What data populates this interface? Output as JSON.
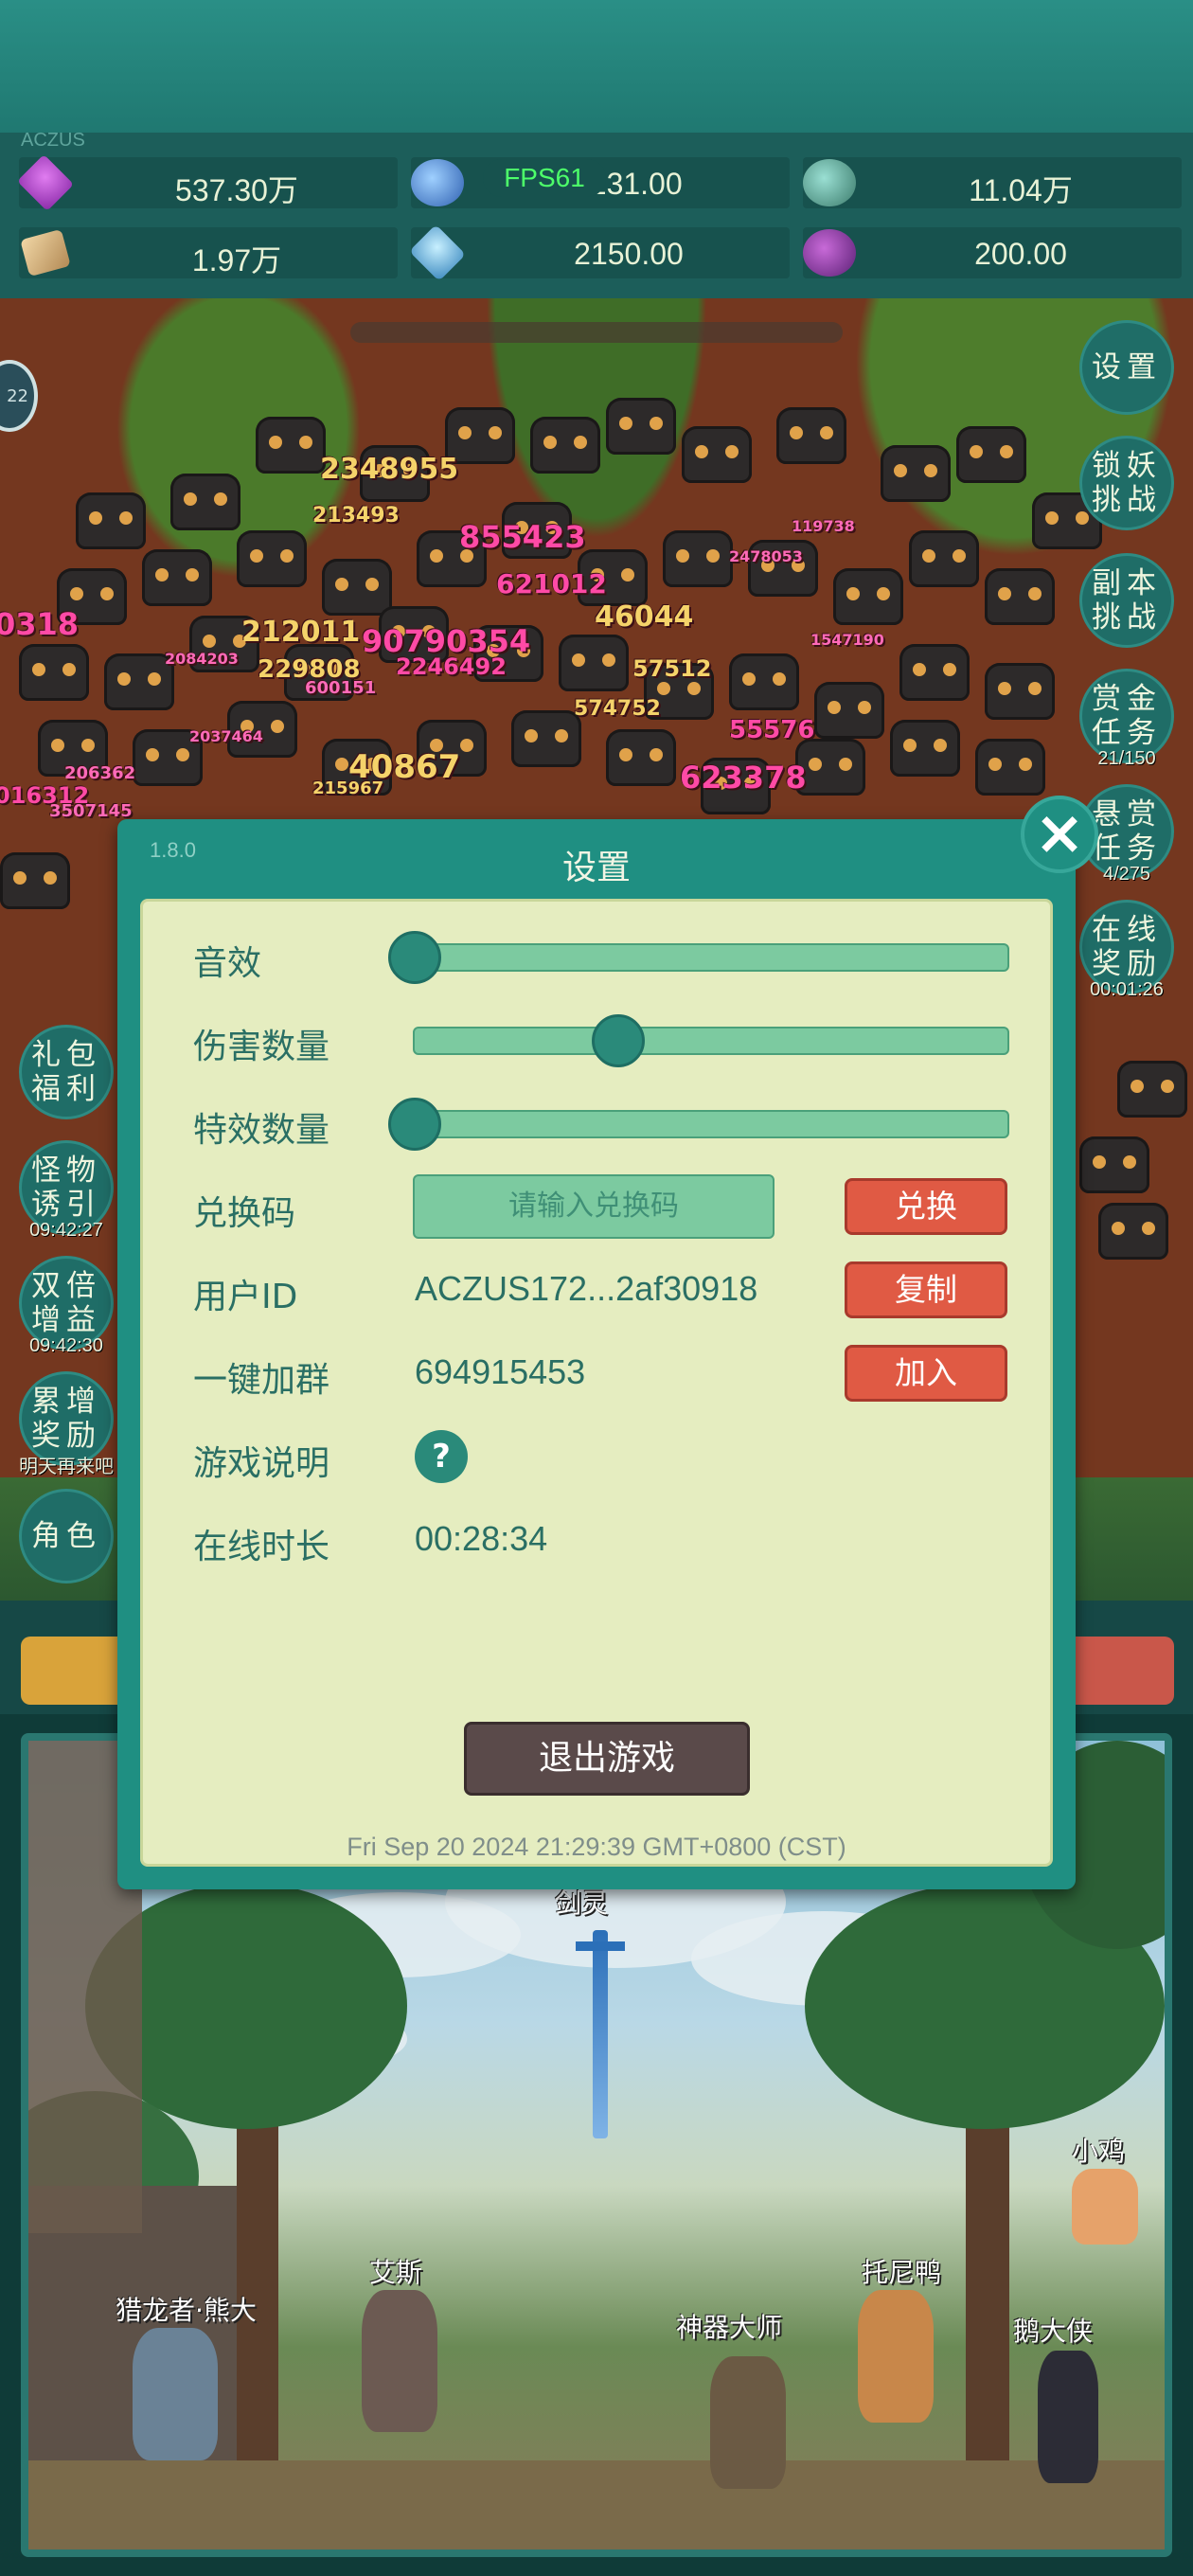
{
  "hud": {
    "fps": "FPS61",
    "player_tag": "ACZUS",
    "resources": [
      {
        "icon": "purple-gem-icon",
        "value": "537.30万"
      },
      {
        "icon": "blue-orb-icon",
        "value": "1131.00"
      },
      {
        "icon": "green-planet-icon",
        "value": "11.04万"
      },
      {
        "icon": "scroll-icon",
        "value": "1.97万"
      },
      {
        "icon": "ice-crystal-icon",
        "value": "2150.00"
      },
      {
        "icon": "purple-fruit-icon",
        "value": "200.00"
      }
    ]
  },
  "right_buttons": [
    {
      "label": [
        "设置"
      ],
      "sub": ""
    },
    {
      "label": [
        "锁妖",
        "挑战"
      ],
      "sub": ""
    },
    {
      "label": [
        "副本",
        "挑战"
      ],
      "sub": ""
    },
    {
      "label": [
        "赏金",
        "任务"
      ],
      "sub": "21/150"
    },
    {
      "label": [
        "悬赏",
        "任务"
      ],
      "sub": "4/275"
    },
    {
      "label": [
        "在线",
        "奖励"
      ],
      "sub": "00:01:26"
    }
  ],
  "left_buttons": [
    {
      "label": [
        "礼包",
        "福利"
      ],
      "sub": ""
    },
    {
      "label": [
        "怪物",
        "诱引"
      ],
      "sub": "09:42:27"
    },
    {
      "label": [
        "双倍",
        "增益"
      ],
      "sub": "09:42:30"
    },
    {
      "label": [
        "累增",
        "奖励"
      ],
      "sub": "明天再来吧"
    },
    {
      "label": [
        "角色"
      ],
      "sub": ""
    }
  ],
  "left_circle_value": "22",
  "damage_numbers": [
    "2348955",
    "213493",
    "855423",
    "621012",
    "212011",
    "90790354",
    "229808",
    "2246492",
    "46044",
    "57512",
    "574752",
    "55576",
    "623378",
    "40867",
    "0318",
    "016312",
    "119738",
    "2478053",
    "1547190",
    "3507145",
    "2084203",
    "2037464",
    "206362",
    "600151",
    "215967"
  ],
  "settings": {
    "version": "1.8.0",
    "title": "设置",
    "sound_label": "音效",
    "sound_level": 0.0,
    "damage_count_label": "伤害数量",
    "damage_count_level": 0.3,
    "effects_count_label": "特效数量",
    "effects_count_level": 0.0,
    "redeem_label": "兑换码",
    "redeem_placeholder": "请输入兑换码",
    "redeem_button": "兑换",
    "user_id_label": "用户ID",
    "user_id_value": "ACZUS172...2af30918",
    "copy_button": "复制",
    "group_label": "一键加群",
    "group_value": "694915453",
    "join_button": "加入",
    "help_label": "游戏说明",
    "help_button": "?",
    "online_label": "在线时长",
    "online_value": "00:28:34",
    "exit_button": "退出游戏",
    "timestamp": "Fri Sep 20 2024 21:29:39 GMT+0800 (CST)"
  },
  "scene": {
    "weapon_label": "剑灵",
    "characters": [
      "猎龙者·熊大",
      "艾斯",
      "神器大师",
      "托尼鸭",
      "鹅大侠",
      "小鸡"
    ]
  }
}
